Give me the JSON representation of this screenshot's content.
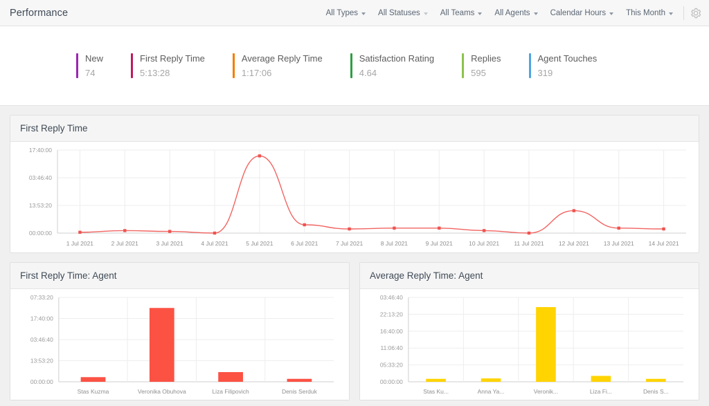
{
  "header": {
    "title": "Performance",
    "filters": [
      {
        "label": "All Types",
        "caret": "chevron-down-icon"
      },
      {
        "label": "All Statuses",
        "caret": "chevron-down-icon"
      },
      {
        "label": "All Teams",
        "caret": "chevron-down-icon"
      },
      {
        "label": "All Agents",
        "caret": "chevron-down-icon"
      },
      {
        "label": "Calendar Hours",
        "caret": "chevron-down-icon"
      },
      {
        "label": "This Month",
        "caret": "chevron-down-icon"
      }
    ],
    "settings_icon": "gear-icon"
  },
  "kpis": [
    {
      "label": "New",
      "value": "74",
      "color": "#9b27b0"
    },
    {
      "label": "First Reply Time",
      "value": "5:13:28",
      "color": "#c2185b"
    },
    {
      "label": "Average Reply Time",
      "value": "1:17:06",
      "color": "#f57c00"
    },
    {
      "label": "Satisfaction Rating",
      "value": "4.64",
      "color": "#2e9e41"
    },
    {
      "label": "Replies",
      "value": "595",
      "color": "#8bc34a"
    },
    {
      "label": "Agent Touches",
      "value": "319",
      "color": "#4fa3e3"
    }
  ],
  "panels": {
    "line": {
      "title": "First Reply Time"
    },
    "bar_left": {
      "title": "First Reply Time: Agent"
    },
    "bar_right": {
      "title": "Average Reply Time: Agent"
    }
  },
  "chart_data": [
    {
      "type": "line",
      "title": "First Reply Time",
      "xlabel": "",
      "ylabel": "",
      "grid": true,
      "legend": null,
      "color": "#ef5350",
      "categories": [
        "1 Jul 2021",
        "2 Jul 2021",
        "3 Jul 2021",
        "4 Jul 2021",
        "5 Jul 2021",
        "6 Jul 2021",
        "7 Jul 2021",
        "8 Jul 2021",
        "9 Jul 2021",
        "10 Jul 2021",
        "11 Jul 2021",
        "12 Jul 2021",
        "13 Jul 2021",
        "14 Jul 2021"
      ],
      "ytick_labels": [
        "17:40:00",
        "03:46:40",
        "13:53:20",
        "00:00:00"
      ],
      "values": [
        0.01,
        0.03,
        0.02,
        0.0,
        0.93,
        0.1,
        0.05,
        0.06,
        0.06,
        0.03,
        0.0,
        0.27,
        0.06,
        0.05
      ],
      "ylim": [
        0,
        1
      ]
    },
    {
      "type": "bar",
      "title": "First Reply Time: Agent",
      "xlabel": "",
      "ylabel": "",
      "grid": true,
      "color": "#fb5244",
      "categories": [
        "Stas Kuzma",
        "Veronika Obuhova",
        "Liza Filipovich",
        "Denis Serduk"
      ],
      "ytick_labels": [
        "07:33:20",
        "17:40:00",
        "03:46:40",
        "13:53:20",
        "00:00:00"
      ],
      "values": [
        0.055,
        0.875,
        0.115,
        0.035
      ],
      "ylim": [
        0,
        1
      ]
    },
    {
      "type": "bar",
      "title": "Average Reply Time: Agent",
      "xlabel": "",
      "ylabel": "",
      "grid": true,
      "color": "#ffd400",
      "categories": [
        "Stas Ku...",
        "Anna Ya...",
        "Veronik...",
        "Liza Fi...",
        "Denis S..."
      ],
      "ytick_labels": [
        "03:46:40",
        "22:13:20",
        "16:40:00",
        "11:06:40",
        "05:33:20",
        "00:00:00"
      ],
      "values": [
        0.035,
        0.04,
        0.885,
        0.07,
        0.035
      ],
      "ylim": [
        0,
        1
      ]
    }
  ]
}
